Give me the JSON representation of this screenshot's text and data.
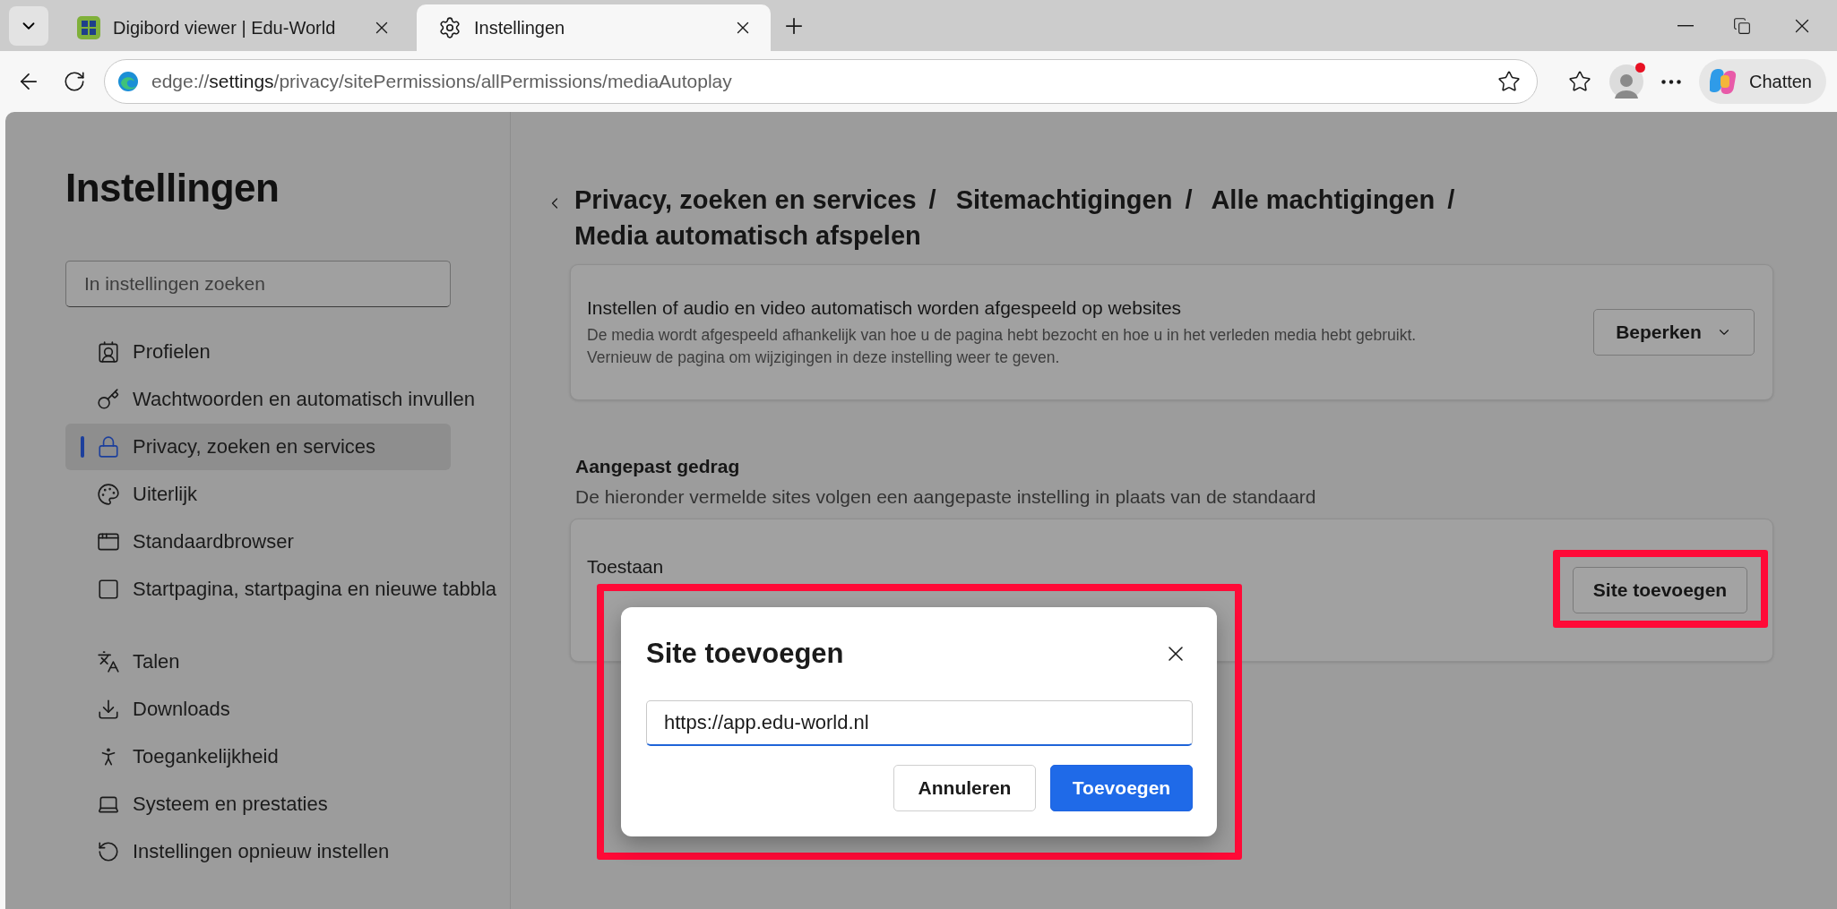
{
  "browser": {
    "tabs": [
      {
        "title": "Digibord viewer | Edu-World",
        "selected": false
      },
      {
        "title": "Instellingen",
        "selected": true
      }
    ],
    "address": "edge://**settings**/privacy/sitePermissions/allPermissions/mediaAutoplay",
    "profile_notification": true,
    "chat_label": "Chatten"
  },
  "sidebar": {
    "title": "Instellingen",
    "search_placeholder": "In instellingen zoeken",
    "sections": [
      [
        {
          "label": "Profielen",
          "selected": false
        },
        {
          "label": "Wachtwoorden en automatisch invullen",
          "selected": false
        },
        {
          "label": "Privacy, zoeken en services",
          "selected": true
        },
        {
          "label": "Uiterlijk",
          "selected": false
        },
        {
          "label": "Standaardbrowser",
          "selected": false
        },
        {
          "label": "Startpagina, startpagina en nieuwe tabbla",
          "selected": false
        }
      ],
      [
        {
          "label": "Talen",
          "selected": false
        },
        {
          "label": "Downloads",
          "selected": false
        },
        {
          "label": "Toegankelijkheid",
          "selected": false
        },
        {
          "label": "Systeem en prestaties",
          "selected": false
        },
        {
          "label": "Instellingen opnieuw instellen",
          "selected": false
        }
      ]
    ]
  },
  "main": {
    "breadcrumb": {
      "separator": "/",
      "items": [
        "Privacy, zoeken en services",
        "Sitemachtigingen",
        "Alle machtigingen",
        "Media automatisch afspelen"
      ]
    },
    "setting": {
      "title": "Instellen of audio en video automatisch worden afgespeeld op websites",
      "description": [
        "De media wordt afgespeeld afhankelijk van hoe u de pagina hebt bezocht en hoe u in het verleden media hebt gebruikt.",
        "Vernieuw de pagina om wijzigingen in deze instelling weer te geven."
      ],
      "dropdown": "Beperken"
    },
    "custom": {
      "heading": "Aangepast gedrag",
      "subtitle": "De hieronder vermelde sites volgen een aangepaste instelling in plaats van de standaard",
      "label": "Toestaan",
      "button": "Site toevoegen",
      "button_highlighted": true
    }
  },
  "dialog": {
    "title": "Site toevoegen",
    "input_value": "https://app.edu-world.nl",
    "input_focused": true,
    "highlighted": true,
    "buttons": [
      {
        "label": "Annuleren",
        "kind": "secondary"
      },
      {
        "label": "Toevoegen",
        "kind": "primary"
      }
    ]
  }
}
